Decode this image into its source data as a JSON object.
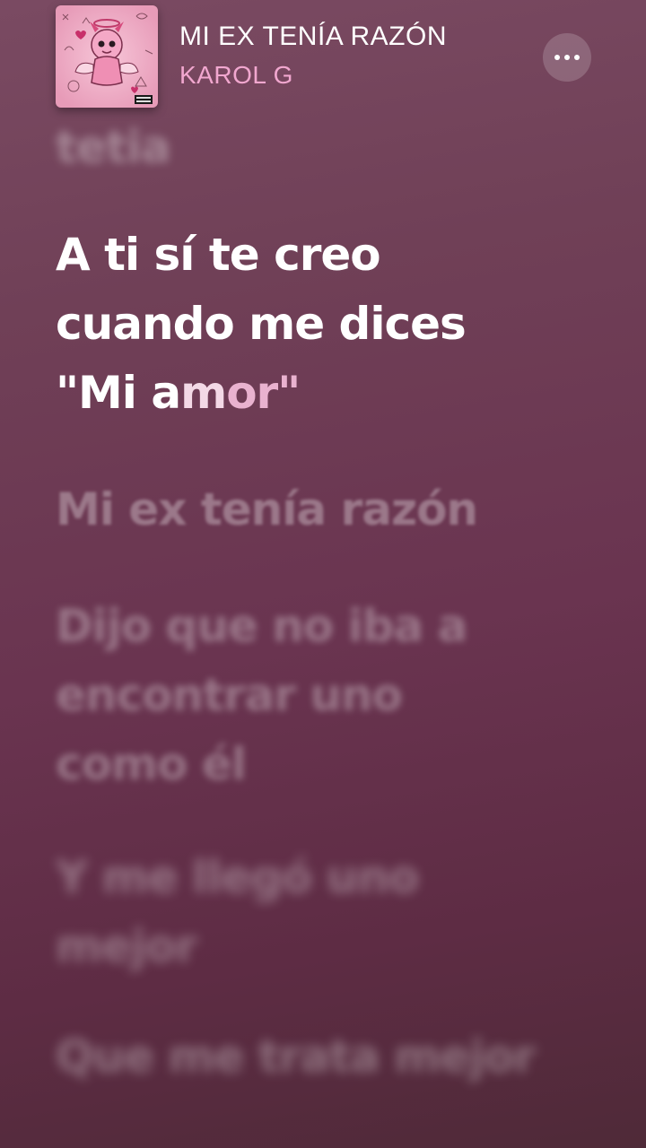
{
  "now_playing": {
    "title": "MI EX TENÍA RAZÓN",
    "artist": "KAROL G",
    "album_art_icon": "album-cover-art"
  },
  "header": {
    "more_icon": "ellipsis-icon"
  },
  "lyrics": {
    "previous": "tetia",
    "active": {
      "line1": "A ti sí te creo",
      "line2": "cuando me dices",
      "line3_sung": "\"Mi a",
      "line3_mid": "m",
      "line3_pending": "or\""
    },
    "upcoming": [
      {
        "lines": [
          "Mi ex tenía razón"
        ]
      },
      {
        "lines": [
          "Dijo que no iba a",
          "encontrar uno",
          "como él"
        ]
      },
      {
        "lines": [
          "Y me llegó uno",
          "mejor"
        ]
      },
      {
        "lines": [
          "Que me trata mejor"
        ]
      }
    ]
  },
  "colors": {
    "background_top": "#7a4a62",
    "background_bottom": "#4f2a38",
    "artist_accent": "#f1a7cf",
    "active_lyric": "#ffffff"
  }
}
